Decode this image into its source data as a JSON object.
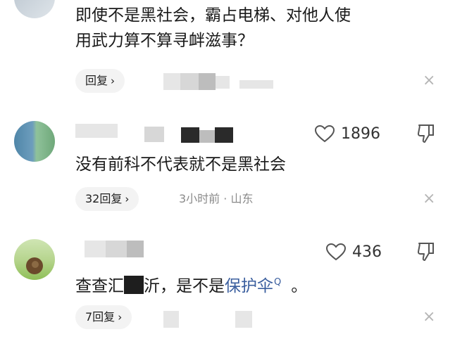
{
  "comments": [
    {
      "text_lines": [
        "即使不是黑社会，霸占电梯、对他人使",
        "用武力算不算寻衅滋事？"
      ],
      "reply_label": "回复",
      "meta": ""
    },
    {
      "likes": "1896",
      "text": "没有前科不代表就不是黑社会",
      "reply_label": "32回复",
      "meta": "3小时前 · 山东"
    },
    {
      "likes": "436",
      "text_before": "查查",
      "text_fragment_a": "汇",
      "text_fragment_b": "沂",
      "text_middle": "，是不是",
      "link_text": "保护伞",
      "search_glyph": "Q",
      "text_end": "。",
      "reply_label": "7回复",
      "meta": ""
    }
  ],
  "icons": {
    "chevron": "›",
    "close": "×",
    "like": "heart-outline-icon",
    "dislike": "thumbs-down-icon"
  },
  "colors": {
    "link": "#3a5e9e",
    "muted": "#8a8a8a",
    "pill_bg": "#f3f3f3"
  }
}
